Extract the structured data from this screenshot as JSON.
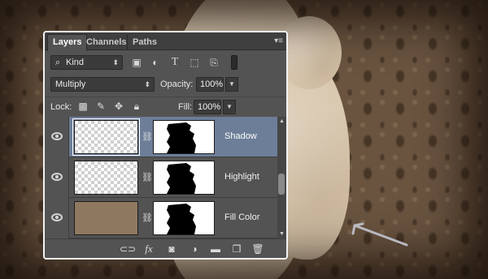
{
  "panel": {
    "tabs": [
      {
        "label": "Layers",
        "active": true
      },
      {
        "label": "Channels",
        "active": false
      },
      {
        "label": "Paths",
        "active": false
      }
    ],
    "menu_glyph": "▾≡"
  },
  "filter": {
    "kind_label": "Kind",
    "icons": [
      "image-filter-icon",
      "adjustment-filter-icon",
      "type-filter-icon",
      "shape-filter-icon",
      "smart-object-filter-icon"
    ]
  },
  "blend": {
    "mode": "Multiply",
    "opacity_label": "Opacity:",
    "opacity_value": "100%"
  },
  "lock": {
    "label": "Lock:",
    "fill_label": "Fill:",
    "fill_value": "100%"
  },
  "layers": [
    {
      "name": "Shadow",
      "selected": true,
      "thumb": "checker"
    },
    {
      "name": "Highlight",
      "selected": false,
      "thumb": "checker"
    },
    {
      "name": "Fill Color",
      "selected": false,
      "thumb": "fill"
    }
  ],
  "colors": {
    "selected_row": "#6d7e98",
    "panel_bg": "#535353",
    "fill_thumb": "#8e7960"
  },
  "bottom_icons": [
    "link-layers-icon",
    "fx-icon",
    "add-mask-icon",
    "adjustment-layer-icon",
    "group-folder-icon",
    "new-layer-icon",
    "trash-icon"
  ],
  "fx_label": "fx"
}
